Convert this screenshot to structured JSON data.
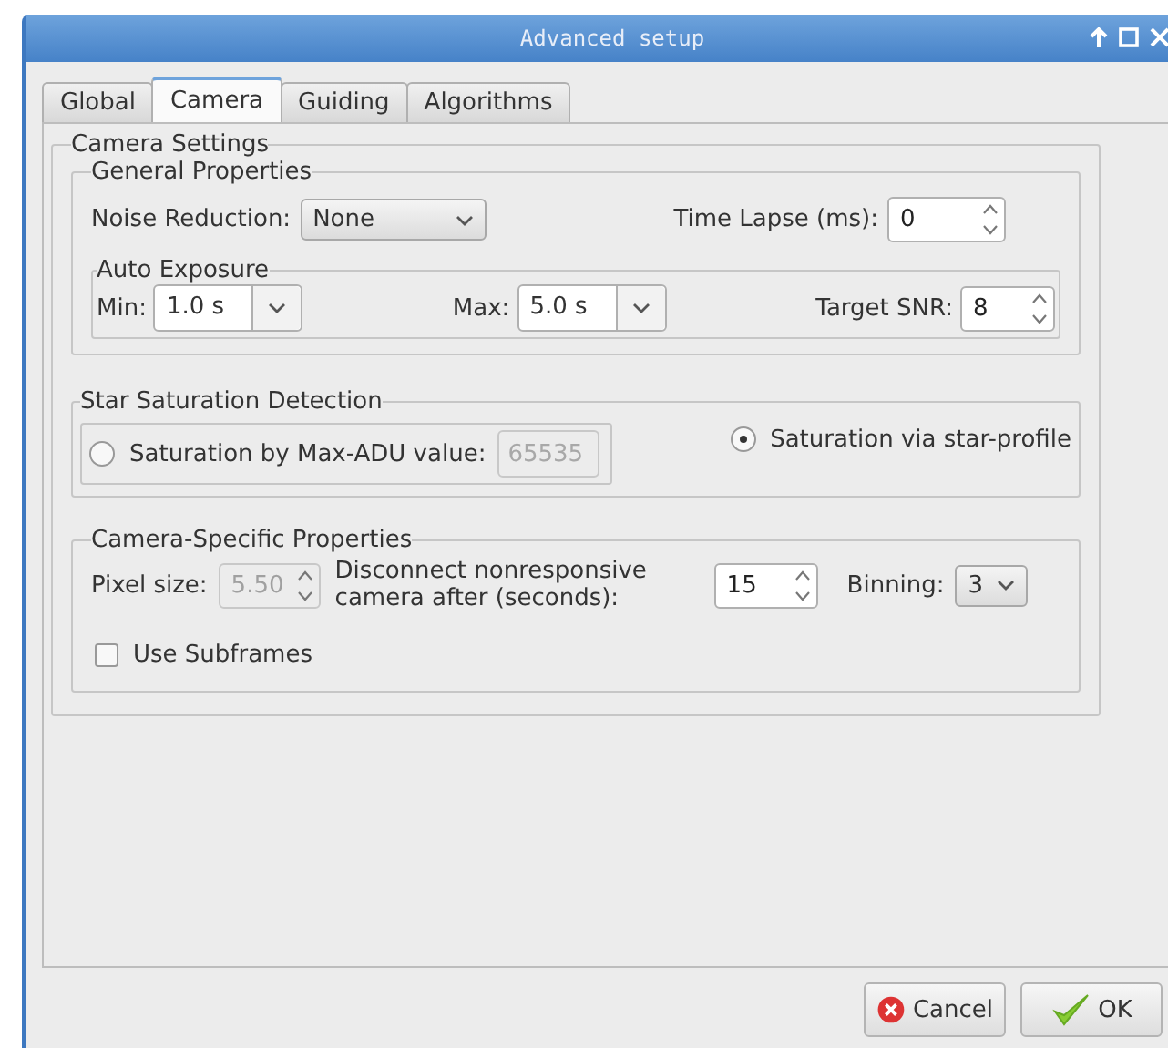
{
  "window": {
    "title": "Advanced setup"
  },
  "tabs": [
    {
      "label": "Global",
      "selected": false
    },
    {
      "label": "Camera",
      "selected": true
    },
    {
      "label": "Guiding",
      "selected": false
    },
    {
      "label": "Algorithms",
      "selected": false
    }
  ],
  "camera_settings": {
    "title": "Camera Settings",
    "general_properties": {
      "title": "General Properties",
      "noise_reduction": {
        "label": "Noise Reduction:",
        "value": "None"
      },
      "time_lapse": {
        "label": "Time Lapse (ms):",
        "value": "0"
      },
      "auto_exposure": {
        "title": "Auto Exposure",
        "min": {
          "label": "Min:",
          "value": "1.0 s"
        },
        "max": {
          "label": "Max:",
          "value": "5.0 s"
        },
        "target_snr": {
          "label": "Target SNR:",
          "value": "8"
        }
      }
    },
    "star_saturation": {
      "title": "Star Saturation Detection",
      "options": [
        {
          "label": "Saturation by Max-ADU value:",
          "selected": false,
          "value": "65535",
          "disabled": true
        },
        {
          "label": "Saturation via star-profile",
          "selected": true
        }
      ]
    },
    "camera_specific": {
      "title": "Camera-Specific Properties",
      "pixel_size": {
        "label": "Pixel size:",
        "value": "5.50",
        "disabled": true
      },
      "disconnect": {
        "label": "Disconnect nonresponsive camera after (seconds):",
        "value": "15"
      },
      "binning": {
        "label": "Binning:",
        "value": "3"
      },
      "use_subframes": {
        "label": "Use Subframes",
        "checked": false
      }
    }
  },
  "buttons": [
    {
      "label": "Cancel",
      "kind": "cancel"
    },
    {
      "label": "OK",
      "kind": "ok"
    }
  ]
}
